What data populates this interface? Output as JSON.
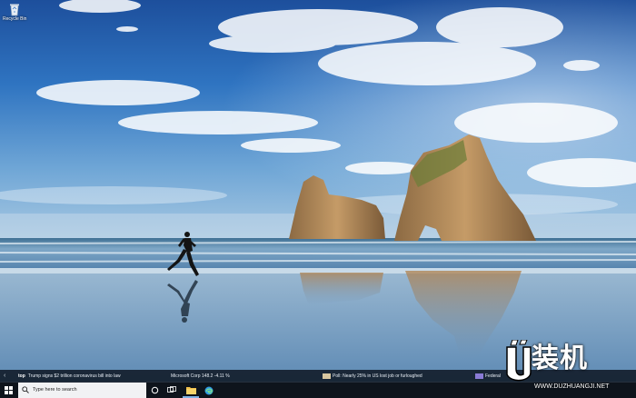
{
  "desktop": {
    "icons": [
      {
        "label": "Recycle Bin",
        "icon": "recycle-bin-icon"
      }
    ]
  },
  "news_bar": {
    "items": [
      {
        "text": "Trump signs $2 trillion coronavirus bill into law",
        "badge": "top"
      },
      {
        "text": "Microsoft Corp   148.2   -4.11 %"
      },
      {
        "text": "Poll: Nearly 25% in US lost job or furloughed"
      },
      {
        "text": "Federal"
      }
    ]
  },
  "taskbar": {
    "search_placeholder": "Type here to search",
    "icons": [
      "windows-start-icon",
      "search-icon",
      "cortana-icon",
      "task-view-icon",
      "file-explorer-icon",
      "edge-icon"
    ]
  },
  "watermark": {
    "brand": "装机",
    "site": "WWW.DUZHUANGJI.NET"
  },
  "colors": {
    "taskbar": "#0e141c",
    "news_bar": "#141e2d",
    "search_box": "#f1f2f4",
    "sky_top": "#1d4f9c",
    "sea": "#6f9cc0"
  }
}
